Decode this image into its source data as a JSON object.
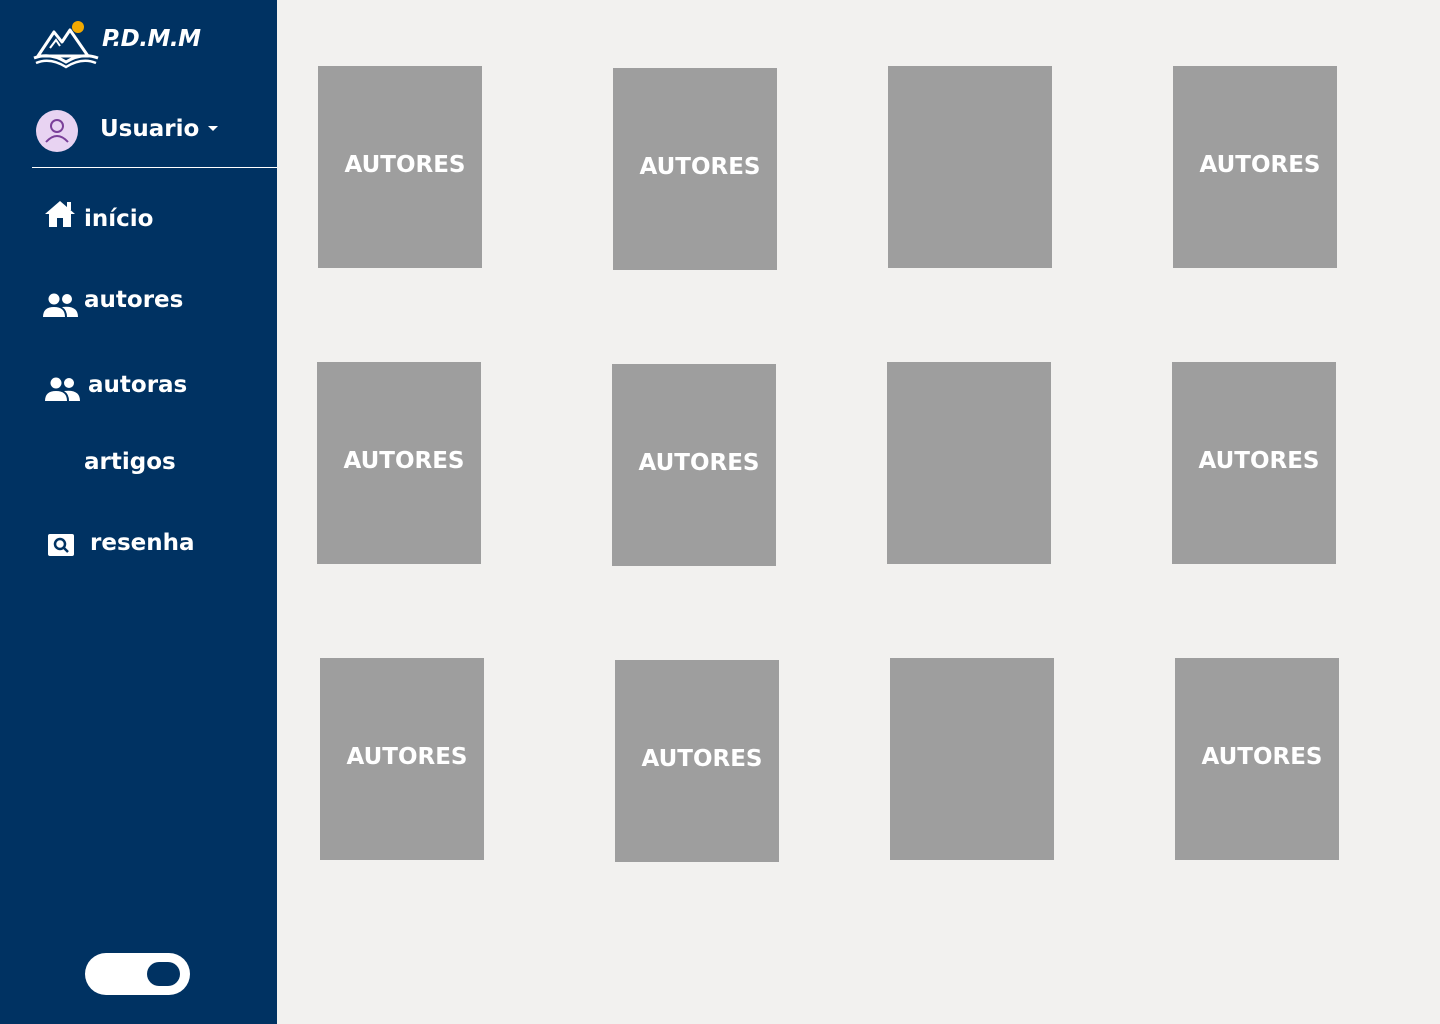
{
  "brand": {
    "logo_text": "P.D.M.M",
    "logo_icon": "open-book-mountains-icon"
  },
  "user": {
    "name": "Usuario",
    "avatar_icon": "user-avatar-icon",
    "caret_icon": "caret-down-icon"
  },
  "nav": {
    "items": [
      {
        "label": "início",
        "icon": "home-icon"
      },
      {
        "label": "autores",
        "icon": "people-icon"
      },
      {
        "label": "autoras",
        "icon": "people-icon"
      },
      {
        "label": "artigos",
        "icon": ""
      },
      {
        "label": "resenha",
        "icon": "image-search-icon"
      }
    ]
  },
  "theme_toggle": {
    "on": true
  },
  "colors": {
    "sidebar": "#003262",
    "background": "#f2f1ef",
    "card": "#9e9e9e",
    "text": "#ffffff",
    "avatar": "#e8d3f2"
  },
  "grid": {
    "cards": [
      {
        "label": "AUTORES"
      },
      {
        "label": "AUTORES"
      },
      {
        "label": ""
      },
      {
        "label": "AUTORES"
      },
      {
        "label": "AUTORES"
      },
      {
        "label": "AUTORES"
      },
      {
        "label": ""
      },
      {
        "label": "AUTORES"
      },
      {
        "label": "AUTORES"
      },
      {
        "label": "AUTORES"
      },
      {
        "label": ""
      },
      {
        "label": "AUTORES"
      }
    ]
  }
}
